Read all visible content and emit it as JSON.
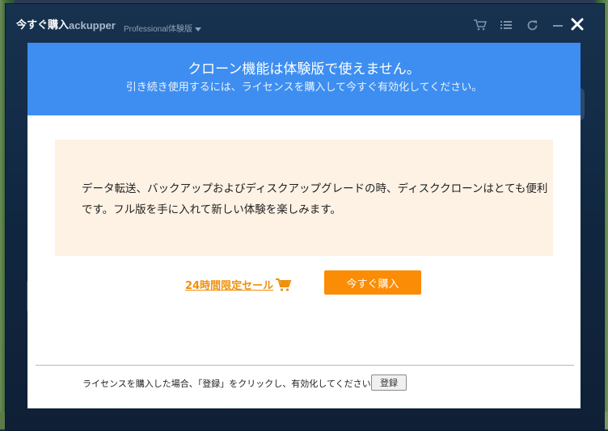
{
  "modal": {
    "title": "今すぐ購入",
    "close_icon": "close-icon"
  },
  "background_app": {
    "logo_text": "ackupper",
    "edition": "Professional体験版",
    "toolbar_icons": [
      "cart-icon",
      "menu-icon",
      "refresh-icon",
      "minimize-icon"
    ]
  },
  "dialog": {
    "heading": "クローン機能は体験版で使えません。",
    "subheading": "引き続き使用するには、ライセンスを購入して今すぐ有効化してください。",
    "body_text": "データ転送、バックアップおよびディスクアップグレードの時、ディスククローンはとても便利です。フル版を手に入れて新しい体験を楽しみます。",
    "sale_link": "24時間限定セール",
    "buy_button": "今すぐ購入",
    "footer_note": "ライセンスを購入した場合、「登録」をクリックし、有効化してください。",
    "register_button": "登録"
  },
  "colors": {
    "header_blue": "#3d8ef0",
    "accent_orange": "#fb8c05",
    "info_box_bg": "#fdf2e4"
  }
}
